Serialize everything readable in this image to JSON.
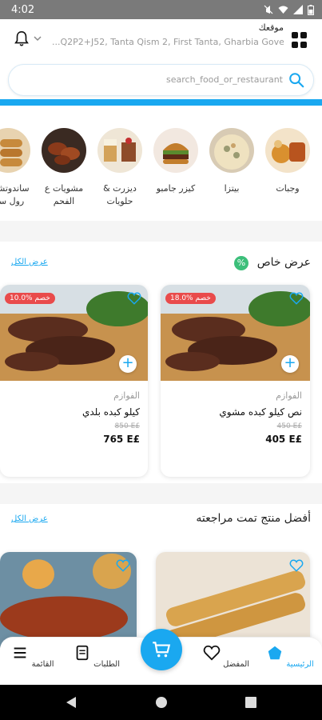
{
  "status_bar": {
    "time": "4:02"
  },
  "header": {
    "location_title": "موقعك",
    "address": "Q2P2+J52, Tanta Qism 2, First Tanta, Gharbia Governorate...",
    "address_display": "...Q2P2+J52, Tanta Qism 2, First Tanta, Gharbia Governorat"
  },
  "search": {
    "placeholder": "search_food_or_restaurant"
  },
  "categories": [
    {
      "label": "وجبات",
      "icon": "meals-image"
    },
    {
      "label": "بيتزا",
      "icon": "pizza-image"
    },
    {
      "label": "كيزر جامبو",
      "icon": "burger-image"
    },
    {
      "label": "ديزرت & حلويات",
      "icon": "dessert-image"
    },
    {
      "label": "مشويات ع الفحم",
      "icon": "grill-image"
    },
    {
      "label": "ساندوتشات رول سي",
      "icon": "sandwich-image"
    }
  ],
  "special_offer": {
    "title": "عرض خاص",
    "badge": "%",
    "see_all": "عرض الكل",
    "products": [
      {
        "discount": "18.0% خصم",
        "restaurant": "الفوازم",
        "name": "نص كيلو كبده مشوي",
        "old_price": "450 E£",
        "price": "405 E£"
      },
      {
        "discount": "10.0% خصم",
        "restaurant": "الفوازم",
        "name": "كيلو كبده بلدي",
        "old_price": "850 E£",
        "price": "765 E£"
      }
    ]
  },
  "top_reviewed": {
    "title": "أفضل منتج تمت مراجعته",
    "see_all": "عرض الكل"
  },
  "bottom_nav": {
    "home": "الرئيسية",
    "favorites": "المفضل",
    "orders": "الطلبات",
    "menu": "القائمة"
  },
  "colors": {
    "accent": "#1aa8f0",
    "discount": "#e94b4b",
    "offer_badge": "#3cbf7a"
  }
}
